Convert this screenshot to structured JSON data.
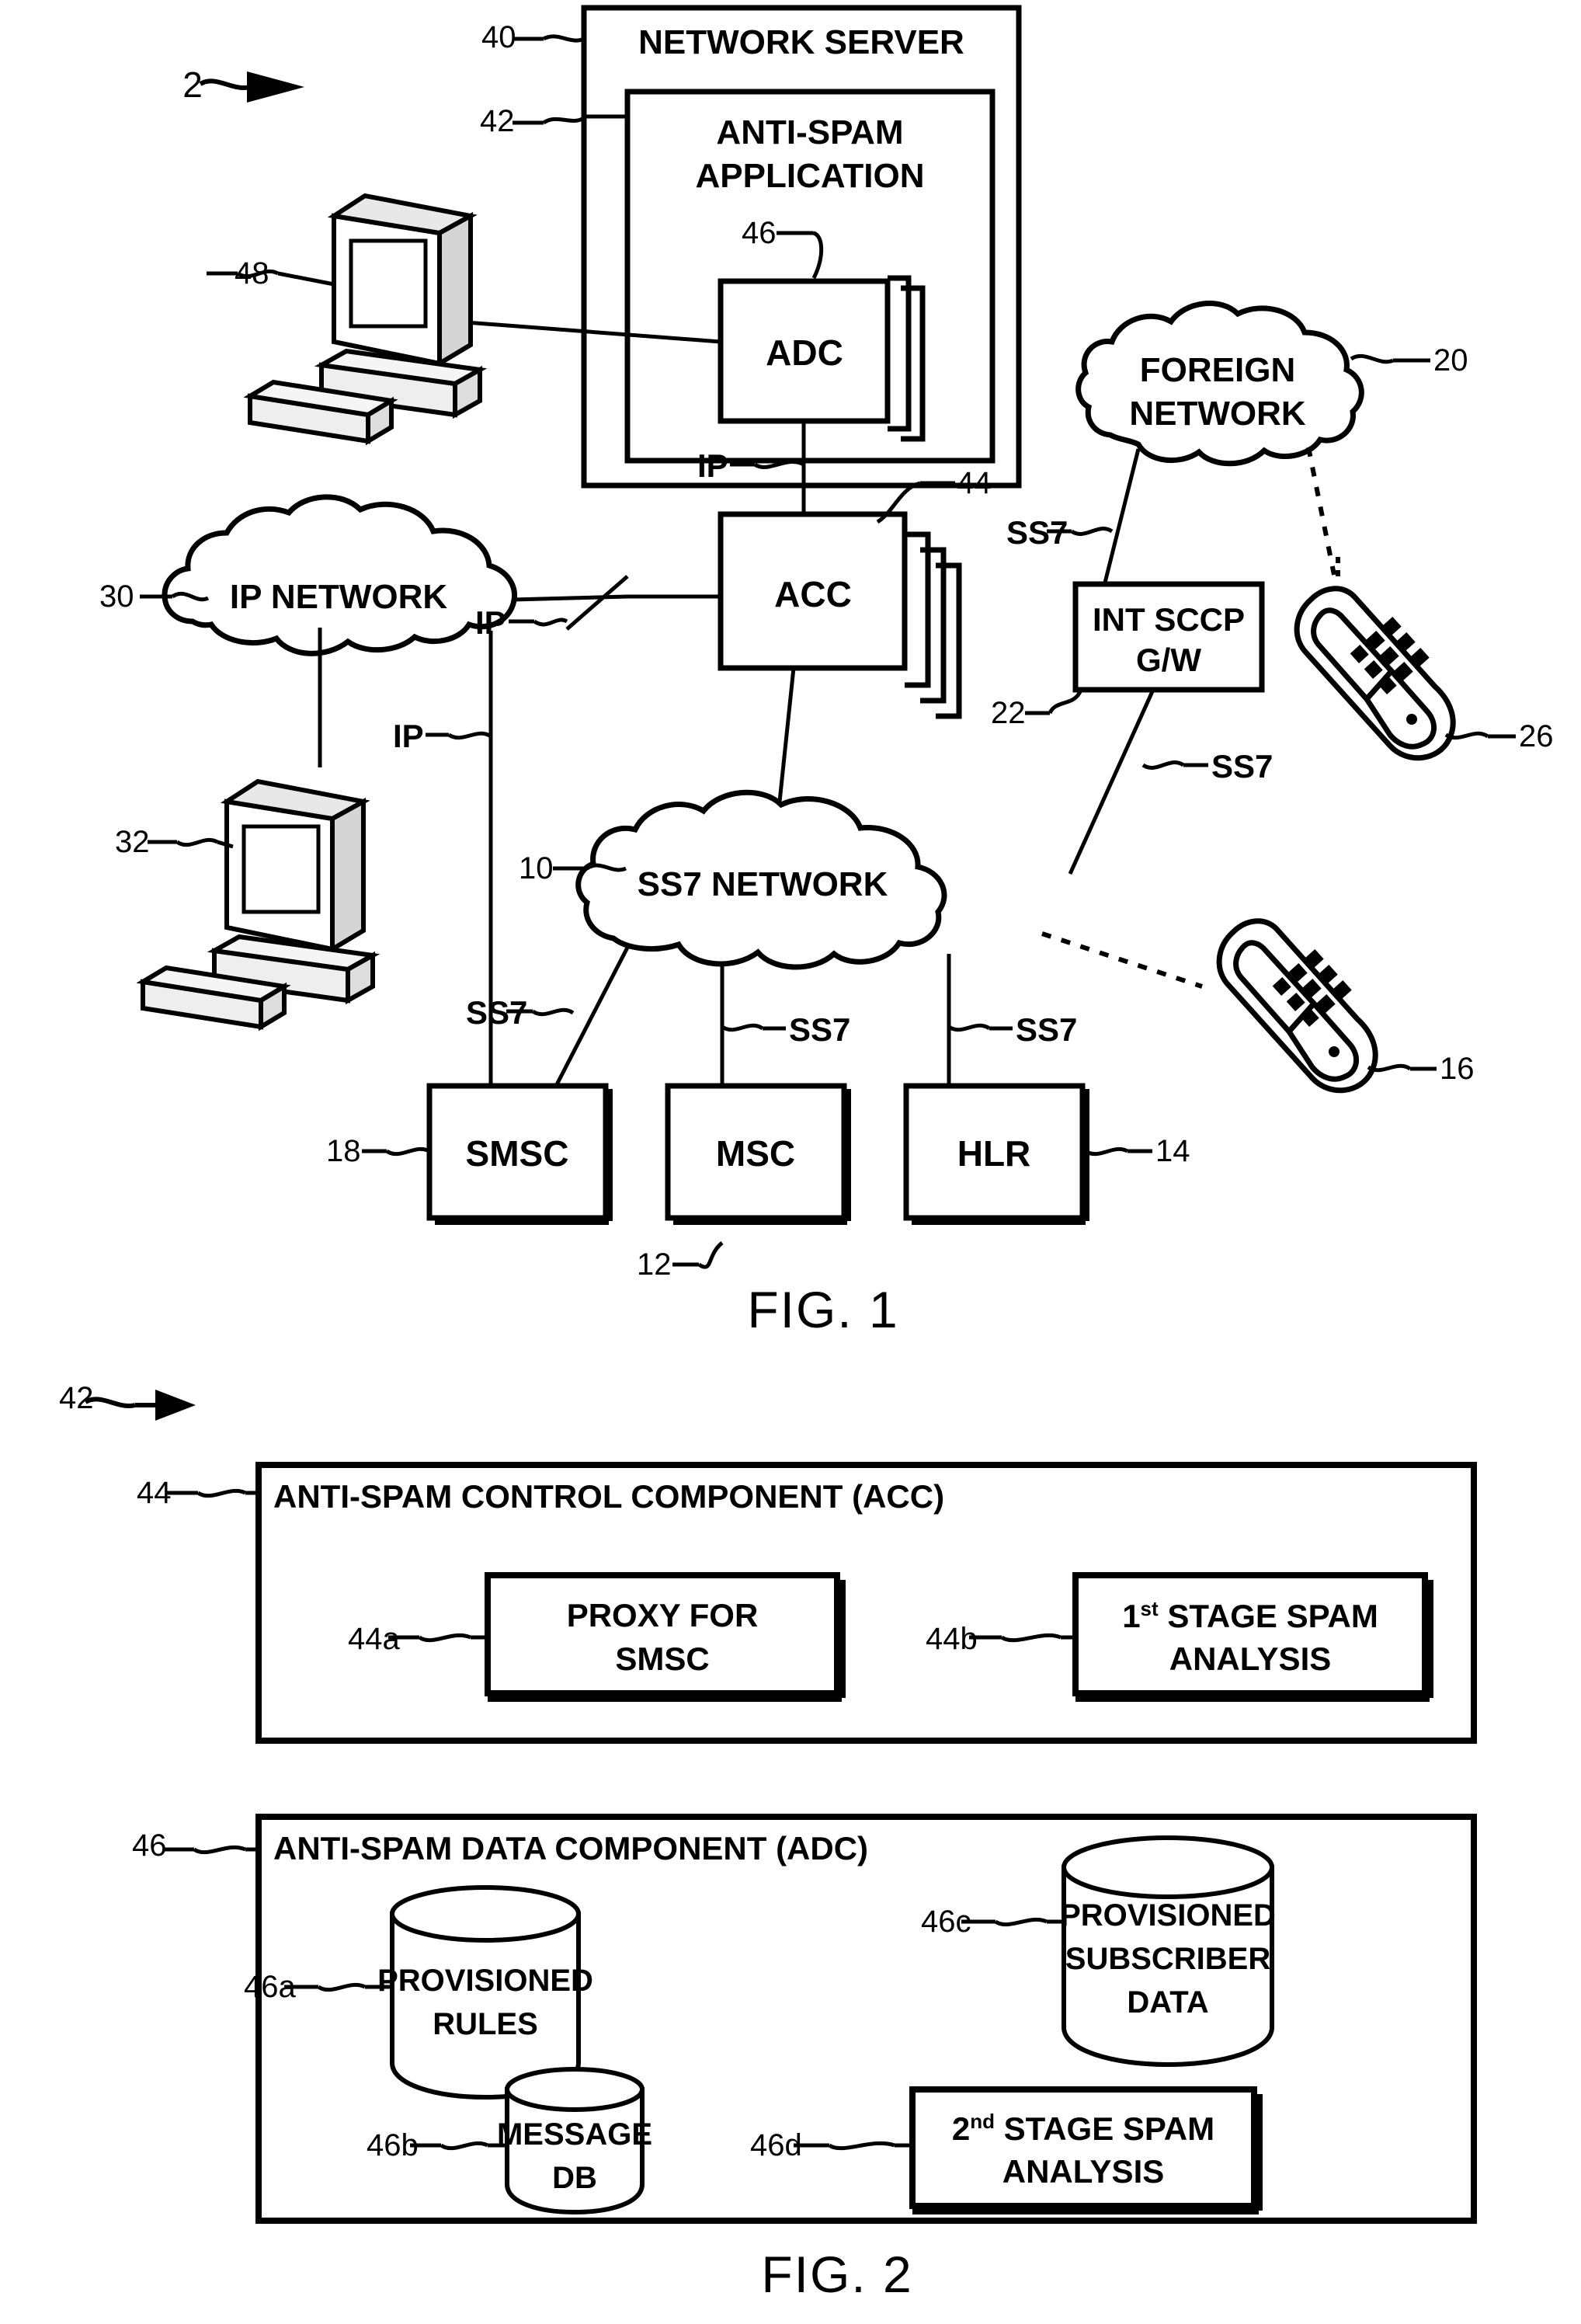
{
  "figure1": {
    "caption": "FIG. 1",
    "system_ref": "2",
    "network_server": {
      "title": "NETWORK SERVER",
      "ref": "40",
      "anti_spam_application": {
        "title_line1": "ANTI-SPAM",
        "title_line2": "APPLICATION",
        "ref": "42",
        "adc_box": {
          "label": "ADC",
          "ref": "46"
        },
        "acc_box": {
          "label": "ACC",
          "ref": "44"
        }
      }
    },
    "clouds": [
      {
        "name": "ip-network",
        "label": "IP NETWORK",
        "ref": "30"
      },
      {
        "name": "foreign-network",
        "label_line1": "FOREIGN",
        "label_line2": "NETWORK",
        "ref": "20"
      },
      {
        "name": "ss7-network",
        "label": "SS7 NETWORK",
        "ref": "10"
      }
    ],
    "nodes": [
      {
        "name": "int-sccp-gw",
        "label_line1": "INT SCCP",
        "label_line2": "G/W",
        "ref": "22"
      },
      {
        "name": "smsc",
        "label": "SMSC",
        "ref": "18"
      },
      {
        "name": "msc",
        "label": "MSC",
        "ref": "12"
      },
      {
        "name": "hlr",
        "label": "HLR",
        "ref": "14"
      }
    ],
    "terminals": [
      {
        "name": "workstation-top",
        "ref": "48"
      },
      {
        "name": "workstation-left",
        "ref": "32"
      },
      {
        "name": "mobile-phone-foreign",
        "ref": "26"
      },
      {
        "name": "mobile-phone-home",
        "ref": "16"
      }
    ],
    "link_labels": {
      "ip_adc": "IP",
      "ip_acc": "IP",
      "ip_network_to_server": "IP",
      "ss7_foreign": "SS7",
      "ss7_gw": "SS7",
      "ss7_smsc": "SS7",
      "ss7_msc": "SS7",
      "ss7_hlr": "SS7"
    }
  },
  "figure2": {
    "caption": "FIG. 2",
    "app_ref": "42",
    "acc_panel": {
      "title": "ANTI-SPAM CONTROL COMPONENT (ACC)",
      "ref": "44",
      "items": [
        {
          "name": "proxy-for-smsc",
          "line1": "PROXY FOR",
          "line2": "SMSC",
          "ref": "44a"
        },
        {
          "name": "first-stage-spam-analysis",
          "line1_pre": "1",
          "line1_sup": "st",
          "line1_post": " STAGE SPAM",
          "line2": "ANALYSIS",
          "ref": "44b"
        }
      ]
    },
    "adc_panel": {
      "title": "ANTI-SPAM DATA COMPONENT (ADC)",
      "ref": "46",
      "items": [
        {
          "name": "provisioned-rules",
          "shape": "cylinder",
          "line1": "PROVISIONED",
          "line2": "RULES",
          "ref": "46a"
        },
        {
          "name": "provisioned-subscriber-data",
          "shape": "cylinder",
          "line1": "PROVISIONED",
          "line2": "SUBSCRIBER",
          "line3": "DATA",
          "ref": "46c"
        },
        {
          "name": "message-db",
          "shape": "cylinder",
          "line1": "MESSAGE",
          "line2": "DB",
          "ref": "46b"
        },
        {
          "name": "second-stage-spam-analysis",
          "shape": "box",
          "line1_pre": "2",
          "line1_sup": "nd",
          "line1_post": " STAGE SPAM",
          "line2": "ANALYSIS",
          "ref": "46d"
        }
      ]
    }
  },
  "colors": {
    "ink": "#000000",
    "paper": "#ffffff"
  }
}
